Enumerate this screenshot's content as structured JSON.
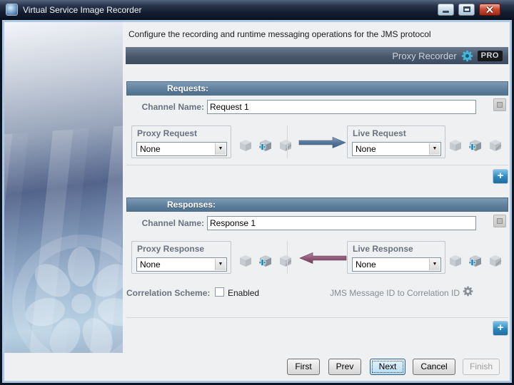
{
  "window": {
    "title": "Virtual Service Image Recorder"
  },
  "intro": "Configure the recording and runtime messaging operations for the JMS protocol",
  "banner": {
    "label": "Proxy Recorder",
    "badge": "PRO"
  },
  "requests": {
    "header": "Requests:",
    "channel_label": "Channel Name:",
    "channel_value": "Request 1",
    "proxy": {
      "title": "Proxy Request",
      "value": "None"
    },
    "live": {
      "title": "Live Request",
      "value": "None"
    }
  },
  "responses": {
    "header": "Responses:",
    "channel_label": "Channel Name:",
    "channel_value": "Response 1",
    "proxy": {
      "title": "Proxy Response",
      "value": "None"
    },
    "live": {
      "title": "Live Response",
      "value": "None"
    }
  },
  "correlation": {
    "label": "Correlation Scheme:",
    "checkbox_label": "Enabled",
    "checked": false,
    "scheme": "JMS Message ID to Correlation ID"
  },
  "footer": {
    "first": "First",
    "prev": "Prev",
    "next": "Next",
    "cancel": "Cancel",
    "finish": "Finish"
  },
  "icons": {
    "plus": "+",
    "dropdown_arrow": "▼"
  },
  "colors": {
    "header_blue": "#5d7e9c",
    "banner_slate": "#46556a",
    "arrow_right": "#54769a",
    "arrow_left": "#91597a",
    "plus_blue": "#2e86bc",
    "gear_teal": "#45b4d6"
  }
}
